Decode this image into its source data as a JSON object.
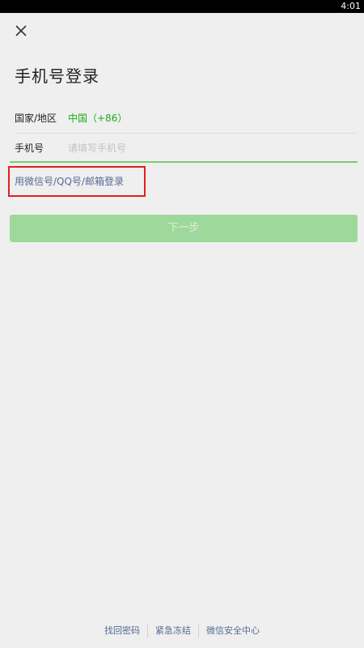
{
  "status_bar": {
    "time": "4:01"
  },
  "header": {
    "close_icon": "close-icon",
    "title": "手机号登录"
  },
  "form": {
    "country_label": "国家/地区",
    "country_value": "中国（+86）",
    "phone_label": "手机号",
    "phone_value": "",
    "phone_placeholder": "请填写手机号"
  },
  "alt_login": {
    "label": "用微信号/QQ号/邮箱登录",
    "highlight_color": "#e02020"
  },
  "next_button": {
    "label": "下一步",
    "state": "disabled"
  },
  "footer": {
    "links": [
      "找回密码",
      "紧急冻结",
      "微信安全中心"
    ]
  },
  "colors": {
    "accent_green": "#1aad19",
    "link_blue": "#576b95",
    "button_disabled": "#9ed99b",
    "background": "#efefef"
  }
}
